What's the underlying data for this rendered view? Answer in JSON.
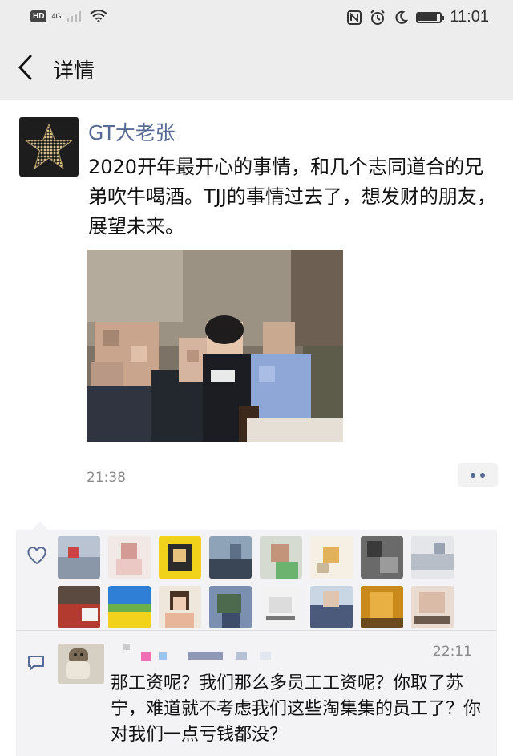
{
  "status_bar": {
    "hd": "HD",
    "network": "4G",
    "time": "11:01",
    "icons": [
      "signal-icon",
      "wifi-icon",
      "nfc-icon",
      "alarm-icon",
      "moon-icon",
      "battery-icon"
    ],
    "battery_level": 0.9
  },
  "nav": {
    "title": "详情",
    "back_icon": "chevron-left-icon"
  },
  "post": {
    "author": "GT大老张",
    "text": "2020开年最开心的事情，和几个志同道合的兄弟吹牛喝酒。TJJ的事情过去了，想发财的朋友，展望未来。",
    "time": "21:38"
  },
  "likes": {
    "icon": "heart-icon",
    "count": 16
  },
  "comment": {
    "icon": "comment-icon",
    "time": "22:11",
    "text": "那工资呢？我们那么多员工工资呢？你取了苏宁，难道就不考虑我们这些淘集集的员工了？你对我们一点亏钱都没？"
  },
  "colors": {
    "link": "#576b95",
    "panel": "#f3f3f5",
    "bar": "#ededed"
  }
}
